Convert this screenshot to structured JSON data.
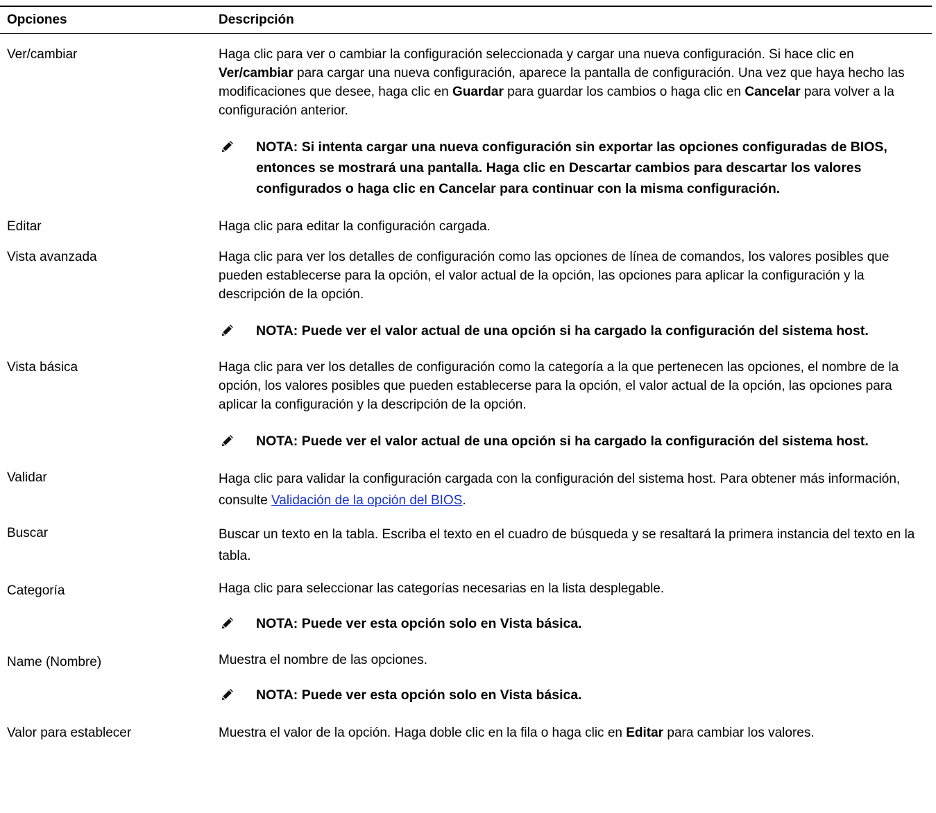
{
  "header": {
    "col_options": "Opciones",
    "col_description": "Descripción"
  },
  "rows": [
    {
      "option": "Ver/cambiar",
      "desc": {
        "t1": "Haga clic para ver o cambiar la configuración seleccionada y cargar una nueva configuración. Si hace clic en ",
        "b1": "Ver/cambiar",
        "t2": " para cargar una nueva configuración, aparece la pantalla de configuración. Una vez que haya hecho las modificaciones que desee, haga clic en ",
        "b2": "Guardar",
        "t3": " para guardar los cambios o haga clic en ",
        "b3": "Cancelar",
        "t4": " para volver a la configuración anterior."
      },
      "note": "NOTA: Si intenta cargar una nueva configuración sin exportar las opciones configuradas de BIOS, entonces se mostrará una pantalla. Haga clic en Descartar cambios para descartar los valores configurados o haga clic en Cancelar para continuar con la misma configuración."
    },
    {
      "option": "Editar",
      "desc": "Haga clic para editar la configuración cargada."
    },
    {
      "option": "Vista avanzada",
      "desc": "Haga clic para ver los detalles de configuración como las opciones de línea de comandos, los valores posibles que pueden establecerse para la opción, el valor actual de la opción, las opciones para aplicar la configuración y la descripción de la opción.",
      "note": "NOTA: Puede ver el valor actual de una opción si ha cargado la configuración del sistema host."
    },
    {
      "option": "Vista básica",
      "desc": "Haga clic para ver los detalles de configuración como la categoría a la que pertenecen las opciones, el nombre de la opción, los valores posibles que pueden establecerse para la opción, el valor actual de la opción, las opciones para aplicar la configuración y la descripción de la opción.",
      "note": "NOTA: Puede ver el valor actual de una opción si ha cargado la configuración del sistema host."
    },
    {
      "option": "Validar",
      "desc": {
        "t1": "Haga clic para validar la configuración cargada con la configuración del sistema host. Para obtener más información, consulte ",
        "link": "Validación de la opción del BIOS",
        "t2": "."
      }
    },
    {
      "option": "Buscar",
      "desc": "Buscar un texto en la tabla. Escriba el texto en el cuadro de búsqueda y se resaltará la primera instancia del texto en la tabla."
    },
    {
      "option": "Categoría",
      "desc": "Haga clic para seleccionar las categorías necesarias en la lista desplegable.",
      "note": "NOTA: Puede ver esta opción solo en Vista básica."
    },
    {
      "option": "Name (Nombre)",
      "desc": "Muestra el nombre de las opciones.",
      "note": "NOTA: Puede ver esta opción solo en Vista básica."
    },
    {
      "option": "Valor para establecer",
      "desc": {
        "t1": "Muestra el valor de la opción. Haga doble clic en la fila o haga clic en ",
        "b1": "Editar",
        "t2": " para cambiar los valores."
      }
    }
  ],
  "icons": {
    "note": "pencil-note-icon"
  }
}
